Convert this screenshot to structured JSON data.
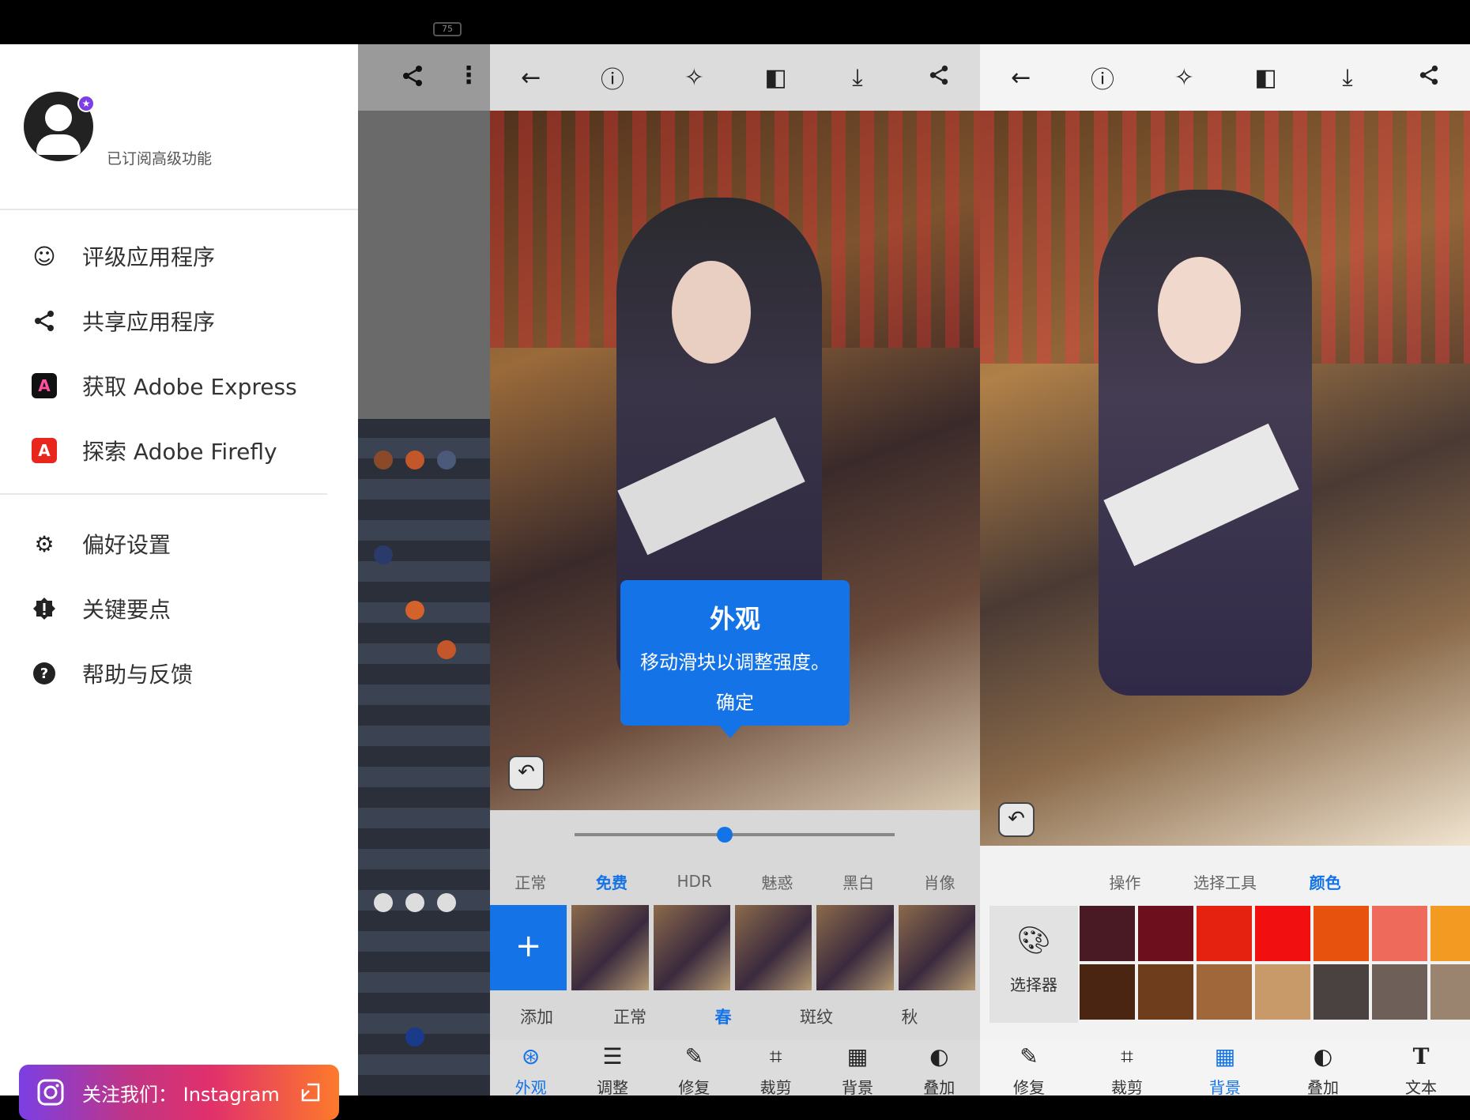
{
  "status": {
    "battery": "75"
  },
  "drawer": {
    "subscription_text": "已订阅高级功能",
    "menu": [
      {
        "label": "评级应用程序",
        "icon": "smile-icon"
      },
      {
        "label": "共享应用程序",
        "icon": "share-icon"
      },
      {
        "label": "获取 Adobe Express",
        "icon": "adobe-express-icon"
      },
      {
        "label": "探索 Adobe Firefly",
        "icon": "adobe-firefly-icon"
      }
    ],
    "settings": [
      {
        "label": "偏好设置",
        "icon": "gear-icon"
      },
      {
        "label": "关键要点",
        "icon": "alert-badge-icon"
      },
      {
        "label": "帮助与反馈",
        "icon": "help-icon"
      }
    ],
    "instagram_label": "关注我们： Instagram"
  },
  "editor1": {
    "tooltip": {
      "title": "外观",
      "body": "移动滑块以调整强度。",
      "ok": "确定"
    },
    "slider_value": 0.47,
    "filter_tabs": [
      {
        "label": "正常",
        "active": false
      },
      {
        "label": "免费",
        "active": true
      },
      {
        "label": "HDR",
        "active": false
      },
      {
        "label": "魅惑",
        "active": false
      },
      {
        "label": "黑白",
        "active": false
      },
      {
        "label": "肖像",
        "active": false
      }
    ],
    "add_label": "添加",
    "looks": [
      "正常",
      "春",
      "斑纹",
      "秋"
    ],
    "active_look": "春",
    "bottom_tabs": [
      {
        "label": "外观",
        "icon": "looks-icon",
        "active": true
      },
      {
        "label": "调整",
        "icon": "sliders-icon",
        "active": false
      },
      {
        "label": "修复",
        "icon": "bandage-icon",
        "active": false
      },
      {
        "label": "裁剪",
        "icon": "crop-icon",
        "active": false
      },
      {
        "label": "背景",
        "icon": "background-icon",
        "active": false
      },
      {
        "label": "叠加",
        "icon": "overlay-icon",
        "active": false
      }
    ]
  },
  "editor2": {
    "subtabs": [
      {
        "label": "操作",
        "active": false
      },
      {
        "label": "选择工具",
        "active": false
      },
      {
        "label": "颜色",
        "active": true
      }
    ],
    "picker_label": "选择器",
    "colors_row1": [
      "#4a1a24",
      "#6e0f1e",
      "#e5220f",
      "#f20f0f",
      "#e8520f",
      "#ee6a5a",
      "#f39a23"
    ],
    "colors_row2": [
      "#4a2612",
      "#6e3e1c",
      "#a0673a",
      "#c89a6a",
      "#4a4240",
      "#6e6058",
      "#9a8470"
    ],
    "bottom_tabs": [
      {
        "label": "修复",
        "icon": "bandage-icon",
        "active": false
      },
      {
        "label": "裁剪",
        "icon": "crop-icon",
        "active": false
      },
      {
        "label": "背景",
        "icon": "background-icon",
        "active": true
      },
      {
        "label": "叠加",
        "icon": "overlay-icon",
        "active": false
      },
      {
        "label": "文本",
        "icon": "text-icon",
        "active": false
      }
    ]
  }
}
